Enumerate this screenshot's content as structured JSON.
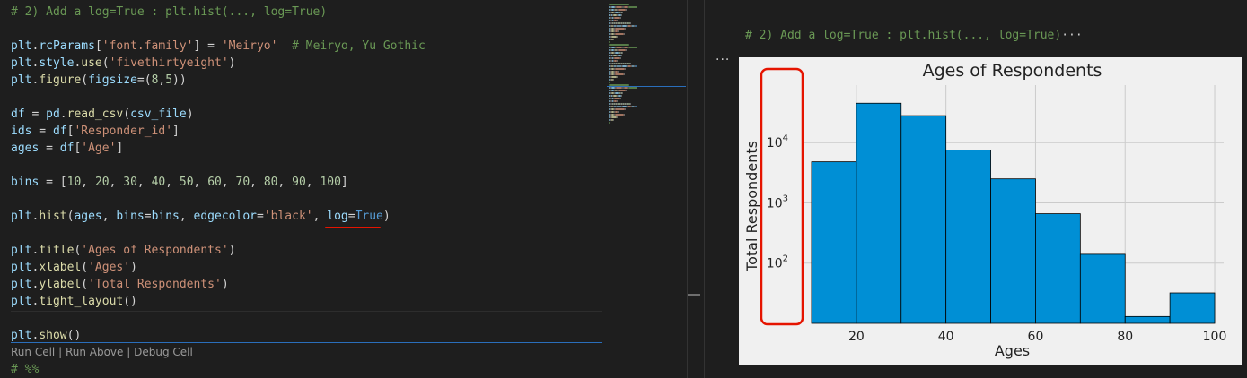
{
  "editor": {
    "lines": [
      {
        "row": 0,
        "tokens": [
          {
            "t": "# 2) Add a log=True : plt.hist(..., log=True)",
            "c": "comment"
          }
        ]
      },
      {
        "row": 2,
        "tokens": [
          {
            "t": "plt",
            "c": "var"
          },
          {
            "t": ".",
            "c": "punct"
          },
          {
            "t": "rcParams",
            "c": "var"
          },
          {
            "t": "[",
            "c": "punct"
          },
          {
            "t": "'font.family'",
            "c": "str"
          },
          {
            "t": "] = ",
            "c": "punct"
          },
          {
            "t": "'Meiryo'",
            "c": "str"
          },
          {
            "t": "  ",
            "c": "punct"
          },
          {
            "t": "# Meiryo, Yu Gothic",
            "c": "comment"
          }
        ]
      },
      {
        "row": 3,
        "tokens": [
          {
            "t": "plt",
            "c": "var"
          },
          {
            "t": ".",
            "c": "punct"
          },
          {
            "t": "style",
            "c": "var"
          },
          {
            "t": ".",
            "c": "punct"
          },
          {
            "t": "use",
            "c": "fn"
          },
          {
            "t": "(",
            "c": "punct"
          },
          {
            "t": "'fivethirtyeight'",
            "c": "str"
          },
          {
            "t": ")",
            "c": "punct"
          }
        ]
      },
      {
        "row": 4,
        "tokens": [
          {
            "t": "plt",
            "c": "var"
          },
          {
            "t": ".",
            "c": "punct"
          },
          {
            "t": "figure",
            "c": "fn"
          },
          {
            "t": "(",
            "c": "punct"
          },
          {
            "t": "figsize",
            "c": "var"
          },
          {
            "t": "=(",
            "c": "punct"
          },
          {
            "t": "8",
            "c": "num"
          },
          {
            "t": ",",
            "c": "punct"
          },
          {
            "t": "5",
            "c": "num"
          },
          {
            "t": "))",
            "c": "punct"
          }
        ]
      },
      {
        "row": 6,
        "tokens": [
          {
            "t": "df",
            "c": "var"
          },
          {
            "t": " = ",
            "c": "punct"
          },
          {
            "t": "pd",
            "c": "var"
          },
          {
            "t": ".",
            "c": "punct"
          },
          {
            "t": "read_csv",
            "c": "fn"
          },
          {
            "t": "(",
            "c": "punct"
          },
          {
            "t": "csv_file",
            "c": "var"
          },
          {
            "t": ")",
            "c": "punct"
          }
        ]
      },
      {
        "row": 7,
        "tokens": [
          {
            "t": "ids",
            "c": "var"
          },
          {
            "t": " = ",
            "c": "punct"
          },
          {
            "t": "df",
            "c": "var"
          },
          {
            "t": "[",
            "c": "punct"
          },
          {
            "t": "'Responder_id'",
            "c": "str"
          },
          {
            "t": "]",
            "c": "punct"
          }
        ]
      },
      {
        "row": 8,
        "tokens": [
          {
            "t": "ages",
            "c": "var"
          },
          {
            "t": " = ",
            "c": "punct"
          },
          {
            "t": "df",
            "c": "var"
          },
          {
            "t": "[",
            "c": "punct"
          },
          {
            "t": "'Age'",
            "c": "str"
          },
          {
            "t": "]",
            "c": "punct"
          }
        ]
      },
      {
        "row": 10,
        "tokens": [
          {
            "t": "bins",
            "c": "var"
          },
          {
            "t": " = [",
            "c": "punct"
          },
          {
            "t": "10",
            "c": "num"
          },
          {
            "t": ", ",
            "c": "punct"
          },
          {
            "t": "20",
            "c": "num"
          },
          {
            "t": ", ",
            "c": "punct"
          },
          {
            "t": "30",
            "c": "num"
          },
          {
            "t": ", ",
            "c": "punct"
          },
          {
            "t": "40",
            "c": "num"
          },
          {
            "t": ", ",
            "c": "punct"
          },
          {
            "t": "50",
            "c": "num"
          },
          {
            "t": ", ",
            "c": "punct"
          },
          {
            "t": "60",
            "c": "num"
          },
          {
            "t": ", ",
            "c": "punct"
          },
          {
            "t": "70",
            "c": "num"
          },
          {
            "t": ", ",
            "c": "punct"
          },
          {
            "t": "80",
            "c": "num"
          },
          {
            "t": ", ",
            "c": "punct"
          },
          {
            "t": "90",
            "c": "num"
          },
          {
            "t": ", ",
            "c": "punct"
          },
          {
            "t": "100",
            "c": "num"
          },
          {
            "t": "]",
            "c": "punct"
          }
        ]
      },
      {
        "row": 12,
        "tokens": [
          {
            "t": "plt",
            "c": "var"
          },
          {
            "t": ".",
            "c": "punct"
          },
          {
            "t": "hist",
            "c": "fn"
          },
          {
            "t": "(",
            "c": "punct"
          },
          {
            "t": "ages",
            "c": "var"
          },
          {
            "t": ", ",
            "c": "punct"
          },
          {
            "t": "bins",
            "c": "var"
          },
          {
            "t": "=",
            "c": "punct"
          },
          {
            "t": "bins",
            "c": "var"
          },
          {
            "t": ", ",
            "c": "punct"
          },
          {
            "t": "edgecolor",
            "c": "var"
          },
          {
            "t": "=",
            "c": "punct"
          },
          {
            "t": "'black'",
            "c": "str"
          },
          {
            "t": ", ",
            "c": "punct"
          },
          {
            "t": "log",
            "c": "var"
          },
          {
            "t": "=",
            "c": "punct"
          },
          {
            "t": "True",
            "c": "kw"
          },
          {
            "t": ")",
            "c": "punct"
          }
        ]
      },
      {
        "row": 14,
        "tokens": [
          {
            "t": "plt",
            "c": "var"
          },
          {
            "t": ".",
            "c": "punct"
          },
          {
            "t": "title",
            "c": "fn"
          },
          {
            "t": "(",
            "c": "punct"
          },
          {
            "t": "'Ages of Respondents'",
            "c": "str"
          },
          {
            "t": ")",
            "c": "punct"
          }
        ]
      },
      {
        "row": 15,
        "tokens": [
          {
            "t": "plt",
            "c": "var"
          },
          {
            "t": ".",
            "c": "punct"
          },
          {
            "t": "xlabel",
            "c": "fn"
          },
          {
            "t": "(",
            "c": "punct"
          },
          {
            "t": "'Ages'",
            "c": "str"
          },
          {
            "t": ")",
            "c": "punct"
          }
        ]
      },
      {
        "row": 16,
        "tokens": [
          {
            "t": "plt",
            "c": "var"
          },
          {
            "t": ".",
            "c": "punct"
          },
          {
            "t": "ylabel",
            "c": "fn"
          },
          {
            "t": "(",
            "c": "punct"
          },
          {
            "t": "'Total Respondents'",
            "c": "str"
          },
          {
            "t": ")",
            "c": "punct"
          }
        ]
      },
      {
        "row": 17,
        "tokens": [
          {
            "t": "plt",
            "c": "var"
          },
          {
            "t": ".",
            "c": "punct"
          },
          {
            "t": "tight_layout",
            "c": "fn"
          },
          {
            "t": "()",
            "c": "punct"
          }
        ]
      },
      {
        "row": 19,
        "tokens": [
          {
            "t": "plt",
            "c": "var"
          },
          {
            "t": ".",
            "c": "punct"
          },
          {
            "t": "show",
            "c": "fn"
          },
          {
            "t": "()",
            "c": "punct"
          }
        ]
      },
      {
        "row": 21,
        "tokens": [
          {
            "t": "# %%",
            "c": "comment"
          }
        ]
      }
    ],
    "codelens": {
      "run_cell": "Run Cell",
      "sep1": " | ",
      "run_above": "Run Above",
      "sep2": " | ",
      "debug_cell": "Debug Cell"
    }
  },
  "output": {
    "header": "# 2) Add a log=True : plt.hist(..., log=True)",
    "header_ellipsis": "···",
    "more_actions": "···"
  },
  "colors": {
    "bar_fill": "#008fd5",
    "highlight": "#e51400",
    "plot_bg": "#f0f0f0"
  },
  "chart_data": {
    "type": "bar",
    "title": "Ages of Respondents",
    "xlabel": "Ages",
    "ylabel": "Total Respondents",
    "bins": [
      10,
      20,
      30,
      40,
      50,
      60,
      70,
      80,
      90,
      100
    ],
    "values": [
      4800,
      45000,
      28000,
      7500,
      2500,
      660,
      140,
      13,
      32
    ],
    "xlim": [
      8,
      102
    ],
    "ylim": [
      10,
      90000
    ],
    "yscale": "log",
    "xticks": [
      20,
      40,
      60,
      80,
      100
    ],
    "yticks": [
      {
        "value": 100,
        "base": "10",
        "exp": "2"
      },
      {
        "value": 1000,
        "base": "10",
        "exp": "3"
      },
      {
        "value": 10000,
        "base": "10",
        "exp": "4"
      }
    ],
    "grid": true,
    "edgecolor": "black"
  }
}
